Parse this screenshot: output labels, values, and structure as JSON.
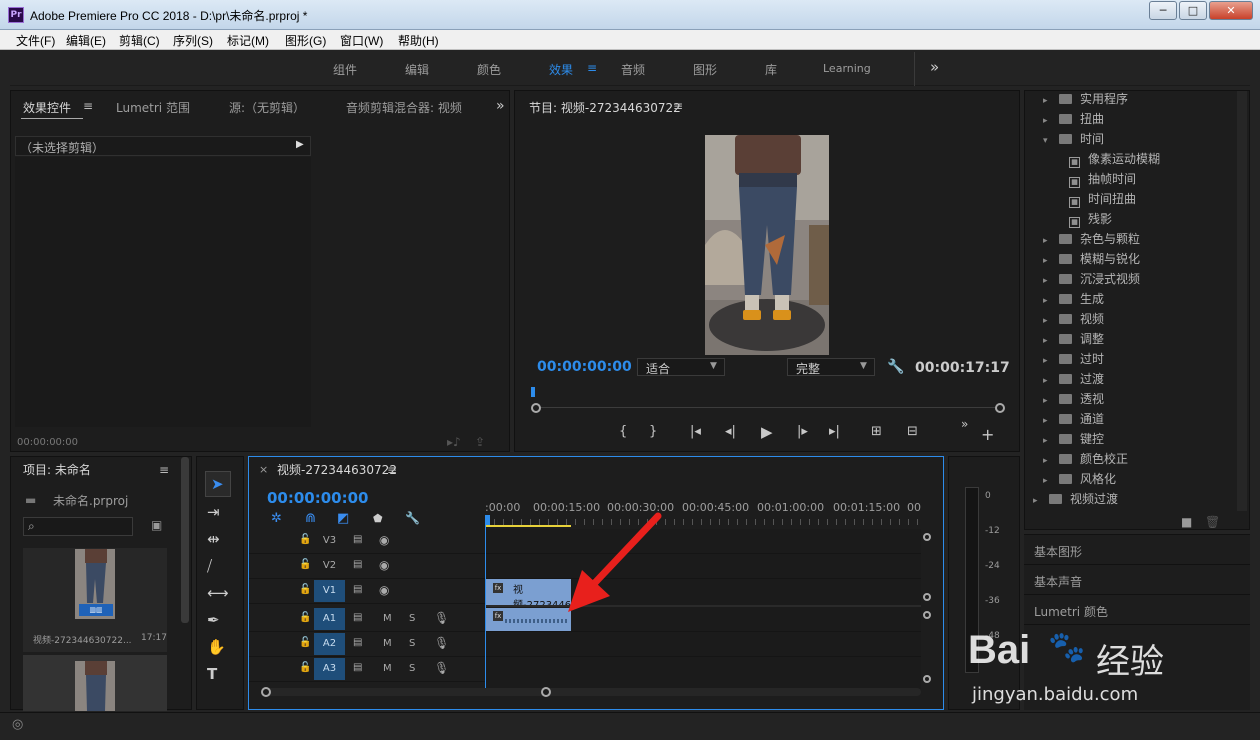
{
  "window": {
    "title": "Adobe Premiere Pro CC 2018 - D:\\pr\\未命名.prproj *",
    "logo": "Pr",
    "min": "─",
    "max": "□",
    "close": "✕"
  },
  "menu": [
    "文件(F)",
    "编辑(E)",
    "剪辑(C)",
    "序列(S)",
    "标记(M)",
    "图形(G)",
    "窗口(W)",
    "帮助(H)"
  ],
  "workspace": {
    "tabs": [
      "组件",
      "编辑",
      "颜色",
      "效果",
      "音频",
      "图形",
      "库",
      "Learning"
    ],
    "active": "效果",
    "overflow": "»"
  },
  "effect_controls": {
    "tabs": [
      "效果控件",
      "Lumetri 范围",
      "源:（无剪辑）",
      "音频剪辑混合器: 视频"
    ],
    "no_clip": "（未选择剪辑）",
    "timecode": "00:00:00:00"
  },
  "program": {
    "title": "节目: 视频-272344630722",
    "timecode": "00:00:00:00",
    "fit": "适合",
    "quality": "完整",
    "duration": "00:00:17:17"
  },
  "project": {
    "title": "项目: 未命名",
    "file": "未命名.prproj",
    "clip_name": "视频-272344630722...",
    "clip_duration": "17:17",
    "search_placeholder": ""
  },
  "timeline": {
    "close": "×",
    "title": "视频-272344630722",
    "timecode": "00:00:00:00",
    "ruler": [
      ":00:00",
      "00:00:15:00",
      "00:00:30:00",
      "00:00:45:00",
      "00:01:00:00",
      "00:01:15:00",
      "00"
    ],
    "video_tracks": [
      "V3",
      "V2",
      "V1"
    ],
    "audio_tracks": [
      "A1",
      "A2",
      "A3"
    ],
    "clip_label": "视频-2723446",
    "mute": "M",
    "solo": "S"
  },
  "meter": {
    "scale": [
      "0",
      "-12",
      "-24",
      "-36",
      "-48"
    ]
  },
  "effects_tree": [
    {
      "label": "实用程序",
      "type": "folder",
      "level": 1
    },
    {
      "label": "扭曲",
      "type": "folder",
      "level": 1
    },
    {
      "label": "时间",
      "type": "folder-open",
      "level": 1
    },
    {
      "label": "像素运动模糊",
      "type": "fx",
      "level": 2
    },
    {
      "label": "抽帧时间",
      "type": "fx",
      "level": 2
    },
    {
      "label": "时间扭曲",
      "type": "fx",
      "level": 2
    },
    {
      "label": "残影",
      "type": "fx",
      "level": 2
    },
    {
      "label": "杂色与颗粒",
      "type": "folder",
      "level": 1
    },
    {
      "label": "模糊与锐化",
      "type": "folder",
      "level": 1
    },
    {
      "label": "沉浸式视频",
      "type": "folder",
      "level": 1
    },
    {
      "label": "生成",
      "type": "folder",
      "level": 1
    },
    {
      "label": "视频",
      "type": "folder",
      "level": 1
    },
    {
      "label": "调整",
      "type": "folder",
      "level": 1
    },
    {
      "label": "过时",
      "type": "folder",
      "level": 1
    },
    {
      "label": "过渡",
      "type": "folder",
      "level": 1
    },
    {
      "label": "透视",
      "type": "folder",
      "level": 1
    },
    {
      "label": "通道",
      "type": "folder",
      "level": 1
    },
    {
      "label": "键控",
      "type": "folder",
      "level": 1
    },
    {
      "label": "颜色校正",
      "type": "folder",
      "level": 1
    },
    {
      "label": "风格化",
      "type": "folder",
      "level": 1
    },
    {
      "label": "视频过渡",
      "type": "folder",
      "level": 0
    }
  ],
  "side_panels": [
    "基本图形",
    "基本声音",
    "Lumetri 颜色"
  ],
  "watermark": {
    "logo": "Bai",
    "logo2": "经验",
    "url": "jingyan.baidu.com"
  },
  "colors": {
    "accent": "#2d8ceb",
    "clip": "#7b9fd1",
    "arrow": "#e8201c"
  }
}
